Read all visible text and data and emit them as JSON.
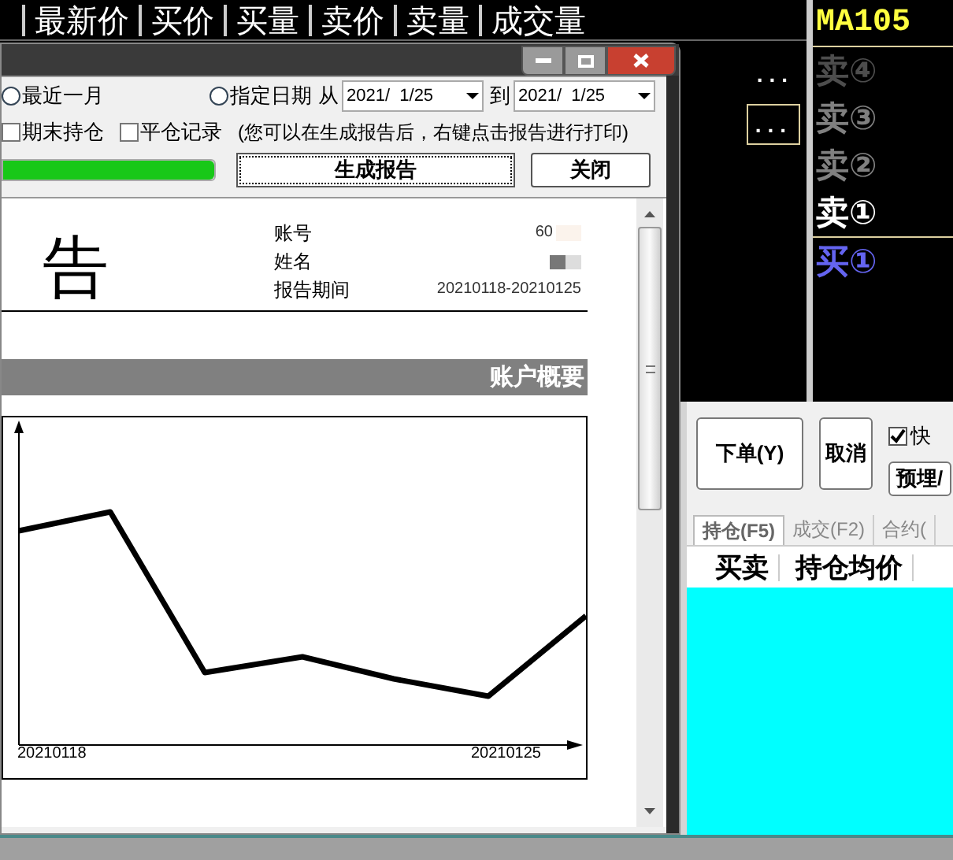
{
  "quote_header": {
    "columns": [
      "最新价",
      "买价",
      "买量",
      "卖价",
      "卖量",
      "成交量"
    ]
  },
  "quote_cells": [
    "...",
    "..."
  ],
  "order_book": {
    "symbol": "MA105",
    "levels": [
      {
        "label": "卖④",
        "color": "#4d4d4d"
      },
      {
        "label": "卖③",
        "color": "#808080"
      },
      {
        "label": "卖②",
        "color": "#808080"
      },
      {
        "label": "卖①",
        "color": "#ffffff"
      },
      {
        "label": "买①",
        "color": "#6464f0"
      }
    ]
  },
  "order_panel": {
    "buttons": [
      "下单(Y)",
      "取消"
    ],
    "quick_checkbox": {
      "label": "快",
      "checked": true
    },
    "preset_button": "预埋/",
    "tabs": [
      {
        "label": "持仓(F5)",
        "selected": true
      },
      {
        "label": "成交(F2)",
        "selected": false
      },
      {
        "label": "合约(",
        "selected": false
      }
    ],
    "columns": [
      "买卖",
      "持仓均价"
    ]
  },
  "dialog": {
    "range_options": [
      {
        "label": "最近一月",
        "selected": false
      },
      {
        "label": "指定日期",
        "selected": false
      }
    ],
    "from_label": "从",
    "from_date": "2021/  1/25",
    "to_label": "到",
    "to_date": "2021/  1/25",
    "checkboxes": [
      {
        "label": "期末持仓",
        "checked": false
      },
      {
        "label": "平仓记录",
        "checked": false
      }
    ],
    "note": "(您可以在生成报告后，右键点击报告进行打印)",
    "progress": {
      "level": 1
    },
    "generate_button": "生成报告",
    "close_button": "关闭",
    "report": {
      "title": "告",
      "info": [
        {
          "label": "账号",
          "value": "60"
        },
        {
          "label": "姓名"
        },
        {
          "label": "报告期间",
          "value": "20210118-20210125"
        }
      ],
      "section_title": "账户概要",
      "chart_labels": [
        "20210118",
        "20210125"
      ]
    }
  }
}
